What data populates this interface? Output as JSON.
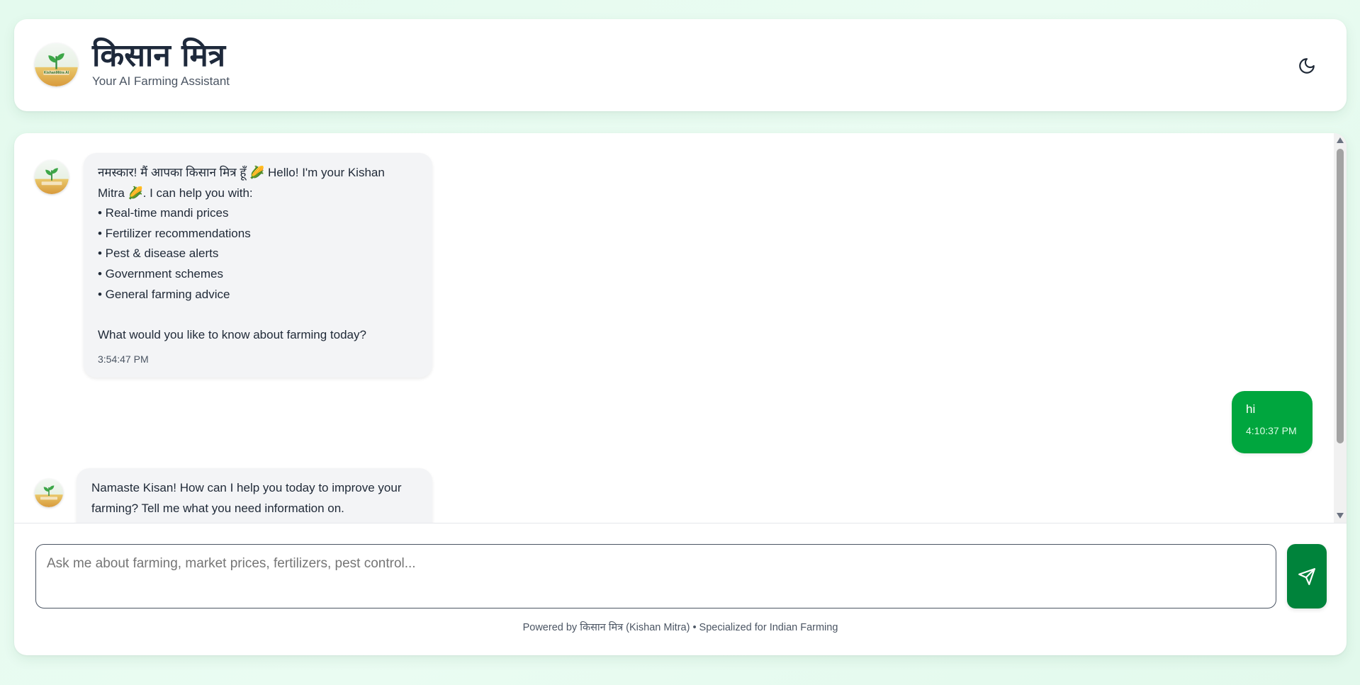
{
  "header": {
    "title": "किसान मित्र",
    "subtitle": "Your AI Farming Assistant",
    "logo_text": "KishanMitra AI",
    "theme_toggle_icon": "moon-icon"
  },
  "messages": {
    "welcome": {
      "lines": [
        "नमस्कार! मैं आपका किसान मित्र हूँ 🌽 Hello! I'm your Kishan",
        "Mitra 🌽. I can help you with:",
        "• Real-time mandi prices",
        "• Fertilizer recommendations",
        "• Pest & disease alerts",
        "• Government schemes",
        "• General farming advice"
      ],
      "closing": "What would you like to know about farming today?",
      "time": "3:54:47 PM"
    },
    "user": {
      "text": "hi",
      "time": "4:10:37 PM"
    },
    "reply": {
      "lines": [
        "Namaste Kisan! How can I help you today to improve your",
        "farming? Tell me what you need information on."
      ]
    }
  },
  "composer": {
    "placeholder": "Ask me about farming, market prices, fertilizers, pest control...",
    "send_icon": "send-icon"
  },
  "footer": {
    "text": "Powered by किसान मित्र (Kishan Mitra) • Specialized for Indian Farming"
  },
  "colors": {
    "accent": "#00a63e",
    "send_button": "#00833b",
    "bot_bubble": "#f3f4f6",
    "background": "#e4faee"
  }
}
